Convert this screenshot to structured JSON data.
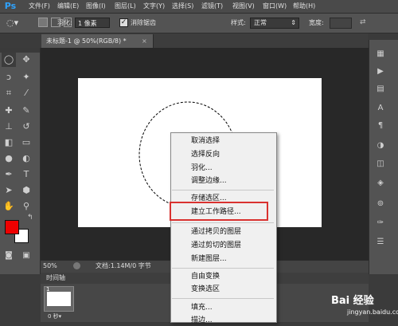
{
  "app": {
    "logo": "Ps"
  },
  "menubar": {
    "items": [
      "文件(F)",
      "编辑(E)",
      "图像(I)",
      "图层(L)",
      "文字(Y)",
      "选择(S)",
      "滤镜(T)",
      "视图(V)",
      "窗口(W)",
      "帮助(H)"
    ]
  },
  "options": {
    "feather_label": "羽化:",
    "feather_value": "1 像素",
    "antialias_label": "消除锯齿",
    "antialias_checked": true,
    "style_label": "样式:",
    "style_value": "正常",
    "width_label": "宽度:"
  },
  "document": {
    "tab_label": "未标题-1 @ 50%(RGB/8) *",
    "close_glyph": "×"
  },
  "colors": {
    "foreground": "#ee0000",
    "background": "#ffffff",
    "highlight": "#d9322f"
  },
  "status": {
    "zoom": "50%",
    "doc_size": "文档:1.14M/0 字节"
  },
  "timeline": {
    "title": "时间轴",
    "frame_number": "1",
    "frame_delay": "0 秒▾"
  },
  "context_menu": {
    "items": [
      {
        "label": "取消选择"
      },
      {
        "label": "选择反向"
      },
      {
        "label": "羽化..."
      },
      {
        "label": "调整边缘..."
      },
      {
        "label": "存储选区..."
      },
      {
        "label": "建立工作路径...",
        "highlighted": true
      },
      {
        "label": "通过拷贝的图层"
      },
      {
        "label": "通过剪切的图层"
      },
      {
        "label": "新建图层..."
      },
      {
        "label": "自由变换"
      },
      {
        "label": "变换选区"
      },
      {
        "label": "填充..."
      },
      {
        "label": "描边..."
      }
    ]
  },
  "watermark": {
    "line1": "Bai 经验",
    "line2": "jingyan.baidu.com"
  }
}
